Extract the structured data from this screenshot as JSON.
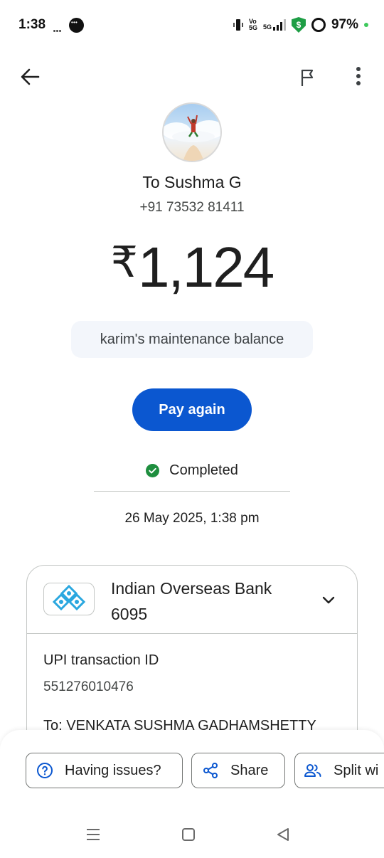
{
  "status_bar": {
    "time": "1:38",
    "battery": "97%",
    "network": "5G"
  },
  "app_bar": {
    "back_icon": "arrow-left-icon",
    "flag_icon": "flag-icon",
    "more_icon": "more-vertical-icon"
  },
  "recipient": {
    "name": "To Sushma G",
    "phone": "+91 73532 81411"
  },
  "payment": {
    "currency": "₹",
    "amount": "1,124",
    "note": "karim's maintenance balance",
    "pay_again_label": "Pay again",
    "status": "Completed",
    "timestamp": "26 May 2025, 1:38 pm"
  },
  "details_card": {
    "bank_name": "Indian Overseas Bank",
    "account_suffix": "6095",
    "txn_id_label": "UPI transaction ID",
    "txn_id": "551276010476",
    "to_line": "To: VENKATA SUSHMA GADHAMSHETTY"
  },
  "actions": {
    "issues_label": "Having issues?",
    "share_label": "Share",
    "split_label": "Split wi"
  },
  "colors": {
    "primary": "#0b57d0",
    "success": "#1e8e3e",
    "chip_bg": "#f3f6fb"
  }
}
